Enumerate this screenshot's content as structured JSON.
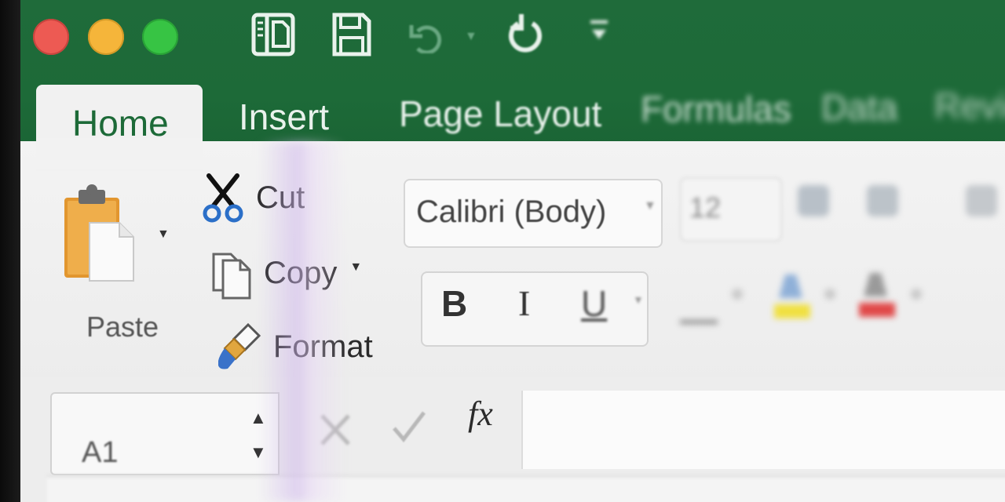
{
  "window": {
    "controls": [
      "close",
      "minimize",
      "maximize"
    ],
    "quick_access": [
      "sidebar-icon",
      "save-icon",
      "undo-icon",
      "redo-icon",
      "customize-icon"
    ]
  },
  "tabs": [
    {
      "label": "Home",
      "active": true
    },
    {
      "label": "Insert",
      "active": false
    },
    {
      "label": "Page Layout",
      "active": false
    },
    {
      "label": "Formulas",
      "active": false
    },
    {
      "label": "Data",
      "active": false
    },
    {
      "label": "Review",
      "active": false
    }
  ],
  "clipboard": {
    "paste_label": "Paste",
    "cut_label": "Cut",
    "copy_label": "Copy",
    "format_label": "Format"
  },
  "font": {
    "name": "Calibri (Body)",
    "size": "12",
    "bold_label": "B",
    "italic_label": "I",
    "underline_label": "U"
  },
  "formula_bar": {
    "name_box": "A1",
    "fx_label": "fx",
    "formula": ""
  },
  "colors": {
    "title_green": "#1d6a38",
    "ribbon_bg": "#ececec",
    "highlight": "#f0e040",
    "font_color": "#e04848"
  },
  "chevron_down": "▼",
  "chevron_up": "▲"
}
